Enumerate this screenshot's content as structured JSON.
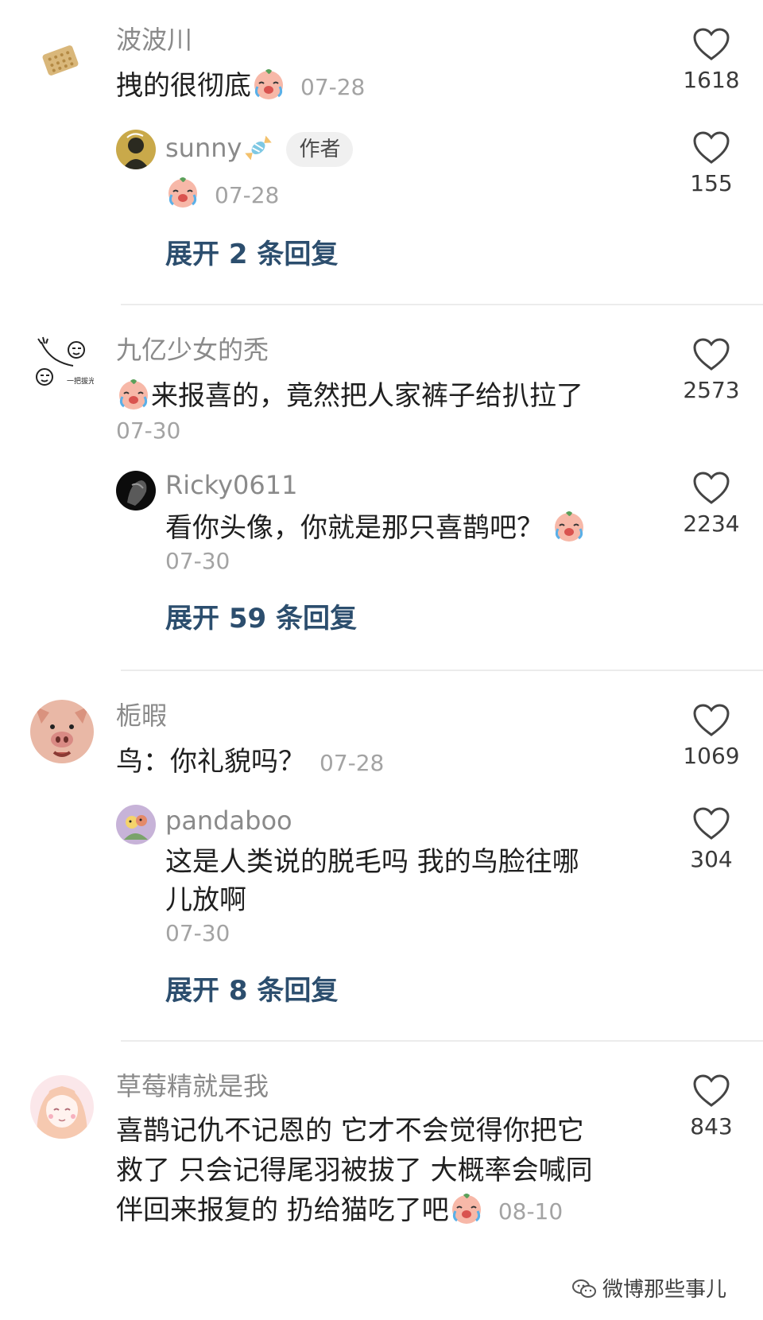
{
  "comments": [
    {
      "user": "波波川",
      "text": "拽的很彻底",
      "date": "07-28",
      "likes": "1618",
      "reply": {
        "user": "sunny",
        "badge": "作者",
        "date": "07-28",
        "likes": "155"
      },
      "expand": "展开 2 条回复"
    },
    {
      "user": "九亿少女的秃",
      "text": "来报喜的，竟然把人家裤子给扒拉了",
      "date": "07-30",
      "likes": "2573",
      "avatar_text": "一把拔光",
      "reply": {
        "user": "Ricky0611",
        "text": "看你头像，你就是那只喜鹊吧？",
        "date": "07-30",
        "likes": "2234"
      },
      "expand": "展开 59 条回复"
    },
    {
      "user": "栀暇",
      "text": "鸟：你礼貌吗？",
      "date": "07-28",
      "likes": "1069",
      "reply": {
        "user": "pandaboo",
        "text_line1": "这是人类说的脱毛吗 我的鸟脸往哪",
        "text_line2": "儿放啊",
        "date": "07-30",
        "likes": "304"
      },
      "expand": "展开 8 条回复"
    },
    {
      "user": "草莓精就是我",
      "text_line1": "喜鹊记仇不记恩的 它才不会觉得你把它",
      "text_line2": "救了 只会记得尾羽被拔了 大概率会喊同",
      "text_line3": "伴回来报复的 扔给猫吃了吧",
      "date": "08-10",
      "likes": "843"
    }
  ],
  "watermark": "微博那些事儿",
  "colors": {
    "username": "#8a8a8a",
    "date": "#a3a3a3",
    "expand_link": "#2c4e6e",
    "divider": "#ececec"
  },
  "icons": {
    "like": "heart-outline-icon",
    "emoji": "crying-face-emoji-icon",
    "sticker": "candy-icon",
    "watermark": "wechat-icon"
  }
}
